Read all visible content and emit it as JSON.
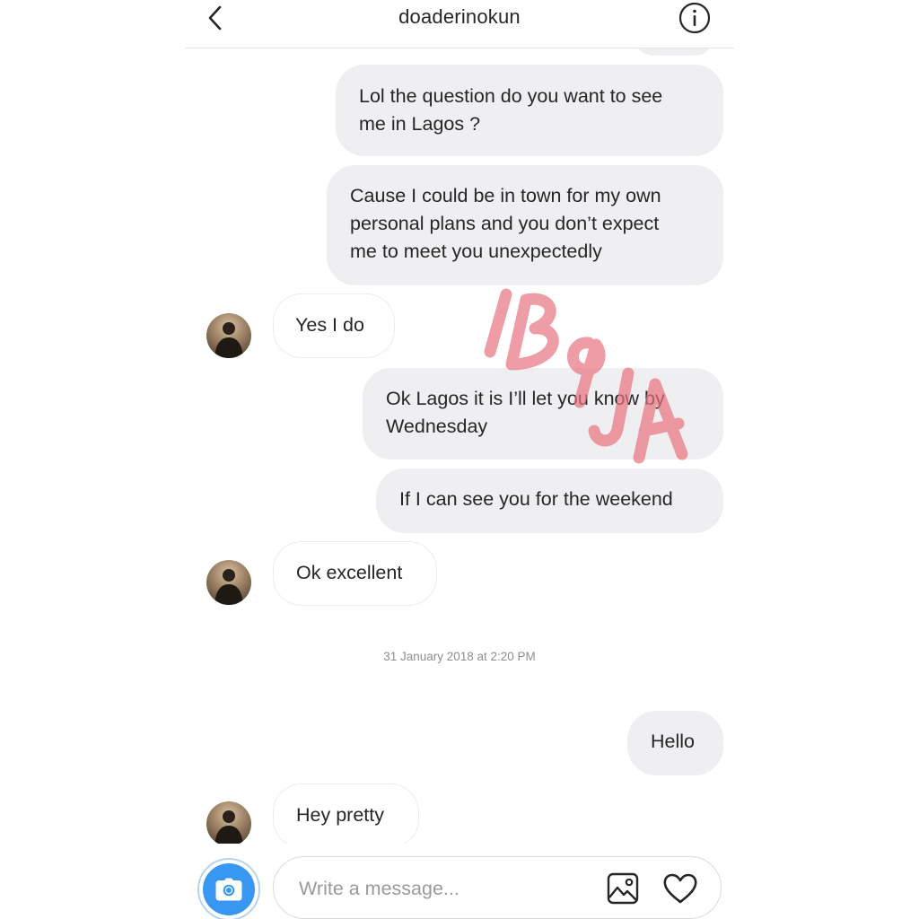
{
  "header": {
    "title": "doaderinokun",
    "back_icon": "chevron-left-icon",
    "info_icon": "info-circle-icon"
  },
  "messages": [
    {
      "direction": "sent",
      "lines": [
        "Lol the question do you want to see",
        "me in Lagos ?"
      ]
    },
    {
      "direction": "sent",
      "lines": [
        "Cause I could be in town for my own",
        "personal plans and you don’t expect",
        "me to meet you unexpectedly"
      ]
    },
    {
      "direction": "received",
      "lines": [
        "Yes I do"
      ]
    },
    {
      "direction": "sent",
      "lines": [
        "Ok Lagos it is I’ll let you know by",
        "Wednesday"
      ]
    },
    {
      "direction": "sent",
      "lines": [
        "If I can see you for the weekend"
      ]
    },
    {
      "direction": "received",
      "lines": [
        "Ok excellent"
      ]
    },
    {
      "direction": "sent",
      "lines": [
        "Hello"
      ]
    },
    {
      "direction": "received",
      "lines": [
        "Hey pretty"
      ]
    }
  ],
  "timestamp": "31 January 2018 at 2:20 PM",
  "watermark": "IB9JA",
  "composer": {
    "placeholder": "Write a message...",
    "camera_icon": "camera-icon",
    "gallery_icon": "image-icon",
    "like_icon": "heart-icon"
  },
  "colors": {
    "sent_bubble": "#efeef1",
    "received_border": "#ececec",
    "accent_blue": "#3897f0",
    "watermark": "#e8737f",
    "timestamp_text": "#8e8e8e"
  }
}
